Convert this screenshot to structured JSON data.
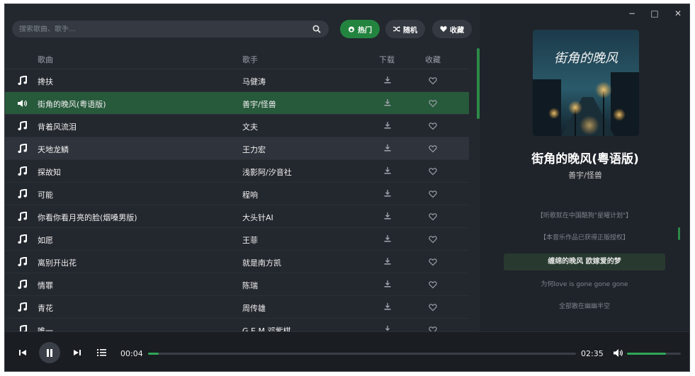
{
  "search": {
    "placeholder": "搜索歌曲、歌手..."
  },
  "filters": [
    {
      "label": "热门",
      "icon": "fire-icon",
      "active": true
    },
    {
      "label": "随机",
      "icon": "shuffle-icon",
      "active": false
    },
    {
      "label": "收藏",
      "icon": "heart-icon",
      "active": false
    }
  ],
  "columns": {
    "song": "歌曲",
    "artist": "歌手",
    "download": "下载",
    "favorite": "收藏"
  },
  "songs": [
    {
      "title": "搀扶",
      "artist": "马健涛"
    },
    {
      "title": "街角的晚风(粤语版)",
      "artist": "善宇/怪兽"
    },
    {
      "title": "背着风流泪",
      "artist": "文夫"
    },
    {
      "title": "天地龙鳞",
      "artist": "王力宏"
    },
    {
      "title": "探故知",
      "artist": "浅影阿/汐音社"
    },
    {
      "title": "可能",
      "artist": "程响"
    },
    {
      "title": "你看你看月亮的脸(烟嗓男版)",
      "artist": "大头针AI"
    },
    {
      "title": "如愿",
      "artist": "王菲"
    },
    {
      "title": "离别开出花",
      "artist": "就是南方凯"
    },
    {
      "title": "情罪",
      "artist": "陈瑞"
    },
    {
      "title": "青花",
      "artist": "周传雄"
    },
    {
      "title": "唯一",
      "artist": "G.E.M.邓紫棋"
    }
  ],
  "playing_index": 1,
  "hover_index": 3,
  "window_controls": {
    "minimize": "−",
    "maximize": "□",
    "close": "✕"
  },
  "now_playing": {
    "title": "街角的晚风(粤语版)",
    "artist": "善宇/怪兽",
    "cover_text": "街角的晚风",
    "lyrics": [
      "【听歌就在中国酷狗\"星曜计划\"】",
      "【本音乐作品已获得正版授权】",
      "缠绵的晚风 欧嫁爱的梦",
      "为何love is gone gone gone",
      "全部散在幽幽半空"
    ],
    "current_lyric_index": 2
  },
  "player": {
    "elapsed": "00:04",
    "duration": "02:35",
    "progress": 0.025,
    "volume": 0.72
  },
  "colors": {
    "accent": "#2fa757",
    "playing_row": "#27593b"
  }
}
